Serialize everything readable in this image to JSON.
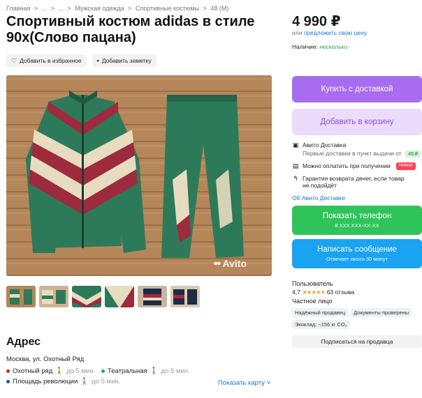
{
  "breadcrumbs": [
    "Главная",
    ">",
    "...",
    ">",
    "...",
    ">",
    "Мужская одежда",
    ">",
    "Спортивные костюмы",
    ">",
    "48 (M)"
  ],
  "listing": {
    "title": "Спортивный костюм adidas в стиле 90х(Слово пацана)",
    "add_favorite": "Добавить в избранное",
    "add_note": "Добавить заметку"
  },
  "photo": {
    "watermark": "Avito"
  },
  "address": {
    "heading": "Адрес",
    "line": "Москва, ул. Охотный Ряд",
    "metro": [
      {
        "name": "Охотный ряд",
        "walk": "до 5 мин.",
        "color": "#d9202b"
      },
      {
        "name": "Театральная",
        "walk": "до 5 мин.",
        "color": "#2ba84a"
      },
      {
        "name": "Площадь революции",
        "walk": "до 5 мин.",
        "color": "#1f4ea8"
      }
    ],
    "map_link": "Показать карту"
  },
  "pricing": {
    "price": "4 990 ₽",
    "offer_prefix": "или",
    "offer_link": "предложить свою цену",
    "availability_label": "Наличие:",
    "availability_value": "несколько"
  },
  "actions": {
    "buy": "Купить с доставкой",
    "cart": "Добавить в корзину",
    "phone": "Показать телефон",
    "phone_sub": "8 XXX XXX-XX-XX",
    "message": "Написать сообщение",
    "message_sub": "Отвечает около 30 минут"
  },
  "delivery": {
    "title": "Авито Доставка",
    "subtitle": "Первые доставки в пункт выдачи от",
    "price_badge": "49 ₽",
    "pay_on_receive": "Можно оплатить при получении",
    "new_badge": "Новое",
    "return_line1": "Гарантия возврата денег, если товар",
    "return_line2": "не подойдёт",
    "link": "Об Авито Доставке"
  },
  "seller": {
    "name": "Пользователь",
    "rating": "4,7",
    "stars": "★★★★★",
    "reviews": "63 отзыва",
    "type": "Частное лицо",
    "tags": [
      "Надёжный продавец",
      "Документы проверены",
      "Экоклад: ~156 кг CO₂"
    ],
    "subscribe": "Подписаться на продавца"
  },
  "colors": {
    "buy": "#a76cf0",
    "cart_bg": "#ecdcfb",
    "phone": "#2fc45a",
    "message": "#1aa3f0",
    "link": "#1a73e8"
  },
  "icons": [
    "heart-icon",
    "note-icon",
    "box-icon",
    "wallet-icon",
    "return-icon",
    "walk-icon",
    "chevron-down-icon"
  ]
}
